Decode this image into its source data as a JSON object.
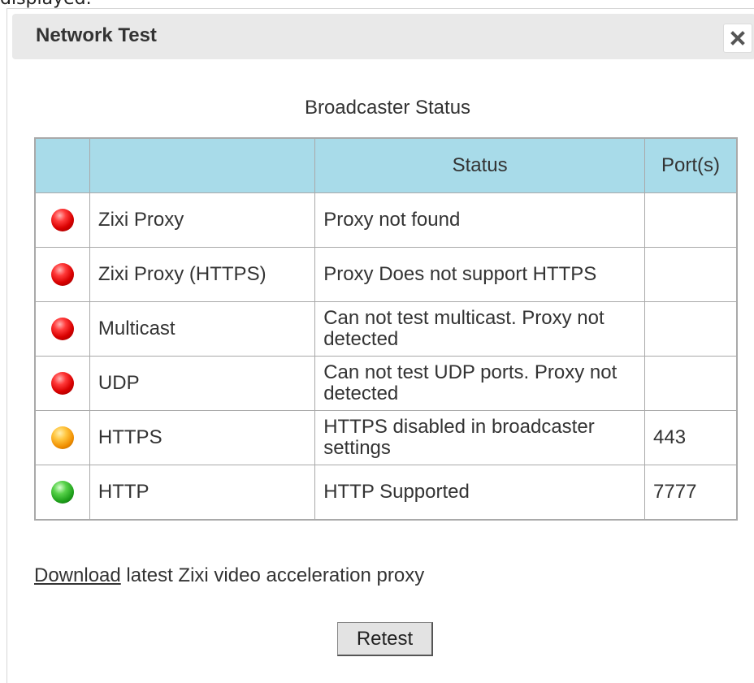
{
  "top_strip_text": "displayed.",
  "dialog": {
    "title": "Network Test",
    "close_icon": "close-icon"
  },
  "section_title": "Broadcaster Status",
  "table": {
    "headers": [
      "",
      "",
      "Status",
      "Port(s)"
    ],
    "rows": [
      {
        "indicator": "red",
        "name": "Zixi Proxy",
        "status": "Proxy not found",
        "ports": ""
      },
      {
        "indicator": "red",
        "name": "Zixi Proxy (HTTPS)",
        "status": "Proxy Does not support HTTPS",
        "ports": ""
      },
      {
        "indicator": "red",
        "name": "Multicast",
        "status": "Can not test multicast. Proxy not detected",
        "ports": ""
      },
      {
        "indicator": "red",
        "name": "UDP",
        "status": "Can not test UDP ports. Proxy not detected",
        "ports": ""
      },
      {
        "indicator": "orange",
        "name": "HTTPS",
        "status": "HTTPS disabled in broadcaster settings",
        "ports": "443"
      },
      {
        "indicator": "green",
        "name": "HTTP",
        "status": "HTTP Supported",
        "ports": "7777"
      }
    ]
  },
  "download": {
    "link_text": "Download",
    "rest_text": " latest Zixi video acceleration proxy"
  },
  "retest_label": "Retest",
  "colors": {
    "header_bg": "#a8dbe9",
    "titlebar_bg": "#e9e9e9",
    "red": "#d90000",
    "orange": "#f08e00",
    "green": "#1ea01a"
  }
}
